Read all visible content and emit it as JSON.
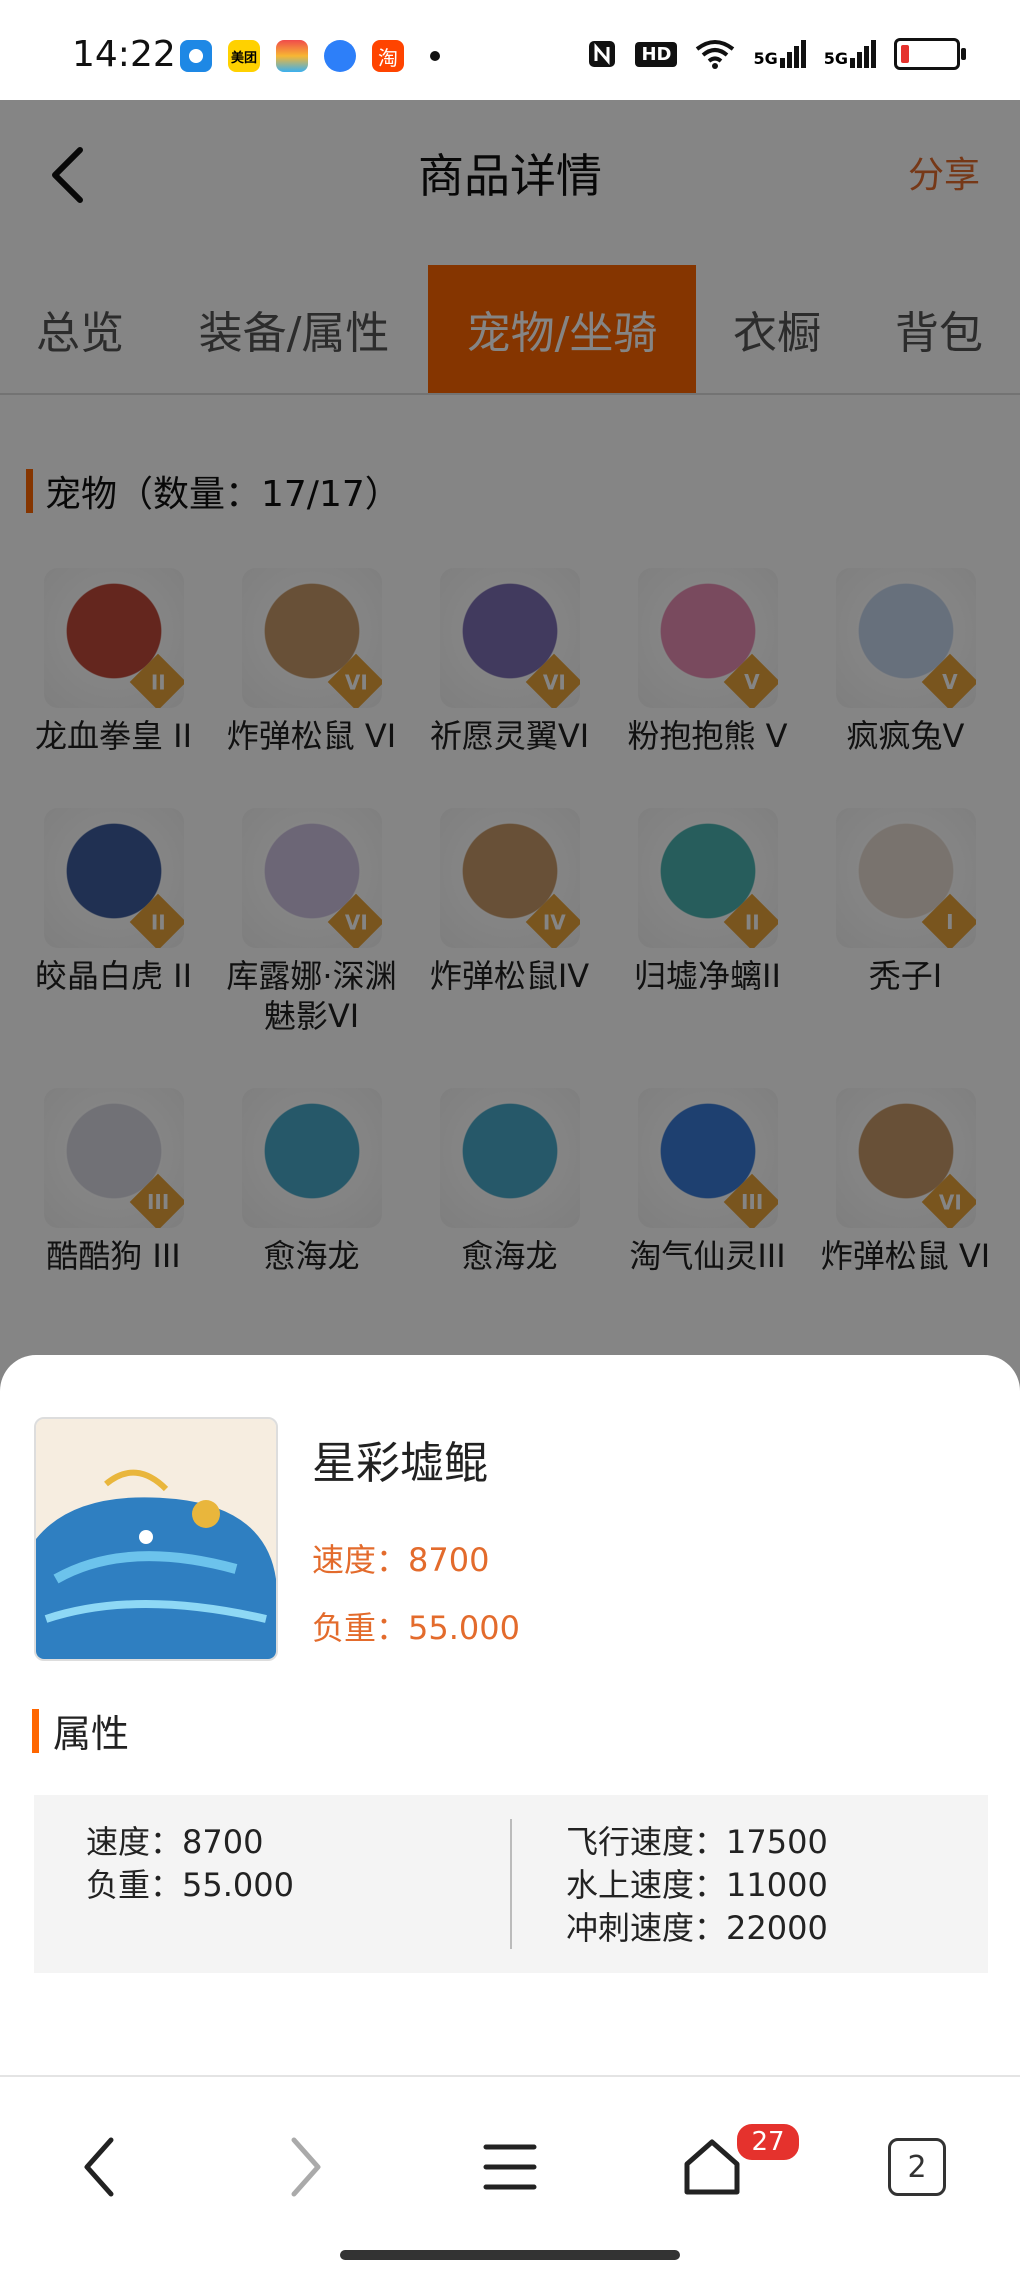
{
  "status_bar": {
    "time": "14:22",
    "apps": [
      {
        "name": "qq-browser-icon",
        "color": "#1e88e5"
      },
      {
        "name": "meituan-icon",
        "color": "#ffd100",
        "text": "美团"
      },
      {
        "name": "multicolor-app-icon",
        "color": "#f27c3a"
      },
      {
        "name": "blue-app-icon",
        "color": "#2d7ff9"
      },
      {
        "name": "taobao-icon",
        "color": "#ff4400",
        "text": "淘"
      }
    ],
    "icons": [
      "nfc-icon",
      "hd-icon",
      "wifi-icon",
      "5g-signal-icon",
      "5g-signal-icon",
      "battery-icon"
    ],
    "hd_text": "HD",
    "signal_labels": [
      "5G",
      "5G"
    ]
  },
  "header": {
    "title": "商品详情",
    "share": "分享"
  },
  "tabs": [
    {
      "label": "总览",
      "active": false
    },
    {
      "label": "装备/属性",
      "active": false
    },
    {
      "label": "宠物/坐骑",
      "active": true
    },
    {
      "label": "衣橱",
      "active": false
    },
    {
      "label": "背包",
      "active": false
    }
  ],
  "pet_section": {
    "title": "宠物（数量：17/17）"
  },
  "pets": [
    {
      "name": "龙血拳皇 II",
      "rank": "II",
      "color": "#c0493a"
    },
    {
      "name": "炸弹松鼠 VI",
      "rank": "VI",
      "color": "#c89a6a"
    },
    {
      "name": "祈愿灵翼VI",
      "rank": "VI",
      "color": "#7d6fb5"
    },
    {
      "name": "粉抱抱熊 V",
      "rank": "V",
      "color": "#e88fb5"
    },
    {
      "name": "疯疯兔V",
      "rank": "V",
      "color": "#c6d6ee"
    },
    {
      "name": "皎晶白虎 II",
      "rank": "II",
      "color": "#3e5d9e"
    },
    {
      "name": "库露娜·深渊魅影VI",
      "rank": "VI",
      "color": "#cfc3e3"
    },
    {
      "name": "炸弹松鼠IV",
      "rank": "IV",
      "color": "#c89a6a"
    },
    {
      "name": "归墟净螭II",
      "rank": "II",
      "color": "#4bb3b0"
    },
    {
      "name": "秃子I",
      "rank": "I",
      "color": "#e9ddd3"
    },
    {
      "name": "酷酷狗 III",
      "rank": "III",
      "color": "#d9d9e3"
    },
    {
      "name": "愈海龙",
      "rank": "",
      "color": "#4aa9c9"
    },
    {
      "name": "愈海龙",
      "rank": "",
      "color": "#4aa9c9"
    },
    {
      "name": "淘气仙灵III",
      "rank": "III",
      "color": "#3a7bd6"
    },
    {
      "name": "炸弹松鼠 VI",
      "rank": "VI",
      "color": "#c89a6a"
    }
  ],
  "detail": {
    "name": "星彩墟鲲",
    "speed_line": "速度：8700",
    "load_line": "负重：55.000",
    "attr_title": "属性",
    "left_attrs": [
      "速度：8700",
      "负重：55.000"
    ],
    "right_attrs": [
      "飞行速度：17500",
      "水上速度：11000",
      "冲刺速度：22000"
    ]
  },
  "bottom_nav": {
    "home_badge": "27",
    "tab_count": "2"
  },
  "colors": {
    "accent": "#ff6600",
    "accent_text": "#e36b2c"
  }
}
